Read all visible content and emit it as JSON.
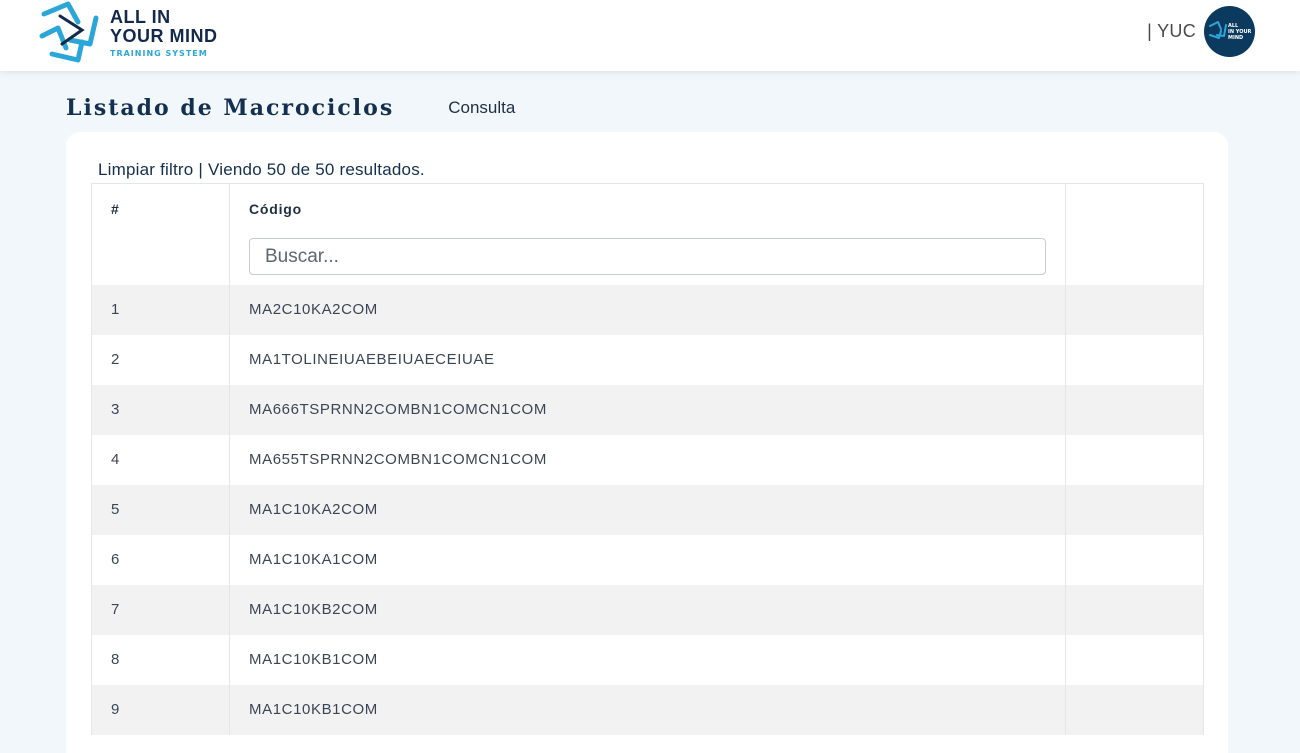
{
  "brand": {
    "line1": "ALL IN",
    "line2": "YOUR MIND",
    "tagline": "TRAINING SYSTEM",
    "primary_color": "#13294b",
    "accent_color": "#2aa7d8"
  },
  "user": {
    "name": "| YUC",
    "avatar_line1": "ALL",
    "avatar_line2": "IN YOUR",
    "avatar_line3": "MIND"
  },
  "page": {
    "title": "Listado de Macrociclos",
    "title_icon": "",
    "breadcrumb_icon": "",
    "breadcrumb_label": "Consulta"
  },
  "filter": {
    "icon": "",
    "clear_label": "Limpiar filtro",
    "separator": "|",
    "results_text": "Viendo 50 de 50 resultados."
  },
  "table": {
    "columns": [
      "#",
      "Código",
      ""
    ],
    "search_placeholder": "Buscar...",
    "action_icon": "",
    "rows": [
      {
        "n": "1",
        "code": "MA2C10KA2COM"
      },
      {
        "n": "2",
        "code": "MA1TOLINEIUAEBEIUAECEIUAE"
      },
      {
        "n": "3",
        "code": "MA666TSPRNN2COMBN1COMCN1COM"
      },
      {
        "n": "4",
        "code": "MA655TSPRNN2COMBN1COMCN1COM"
      },
      {
        "n": "5",
        "code": "MA1C10KA2COM"
      },
      {
        "n": "6",
        "code": "MA1C10KA1COM"
      },
      {
        "n": "7",
        "code": "MA1C10KB2COM"
      },
      {
        "n": "8",
        "code": "MA1C10KB1COM"
      },
      {
        "n": "9",
        "code": "MA1C10KB1COM"
      }
    ]
  }
}
